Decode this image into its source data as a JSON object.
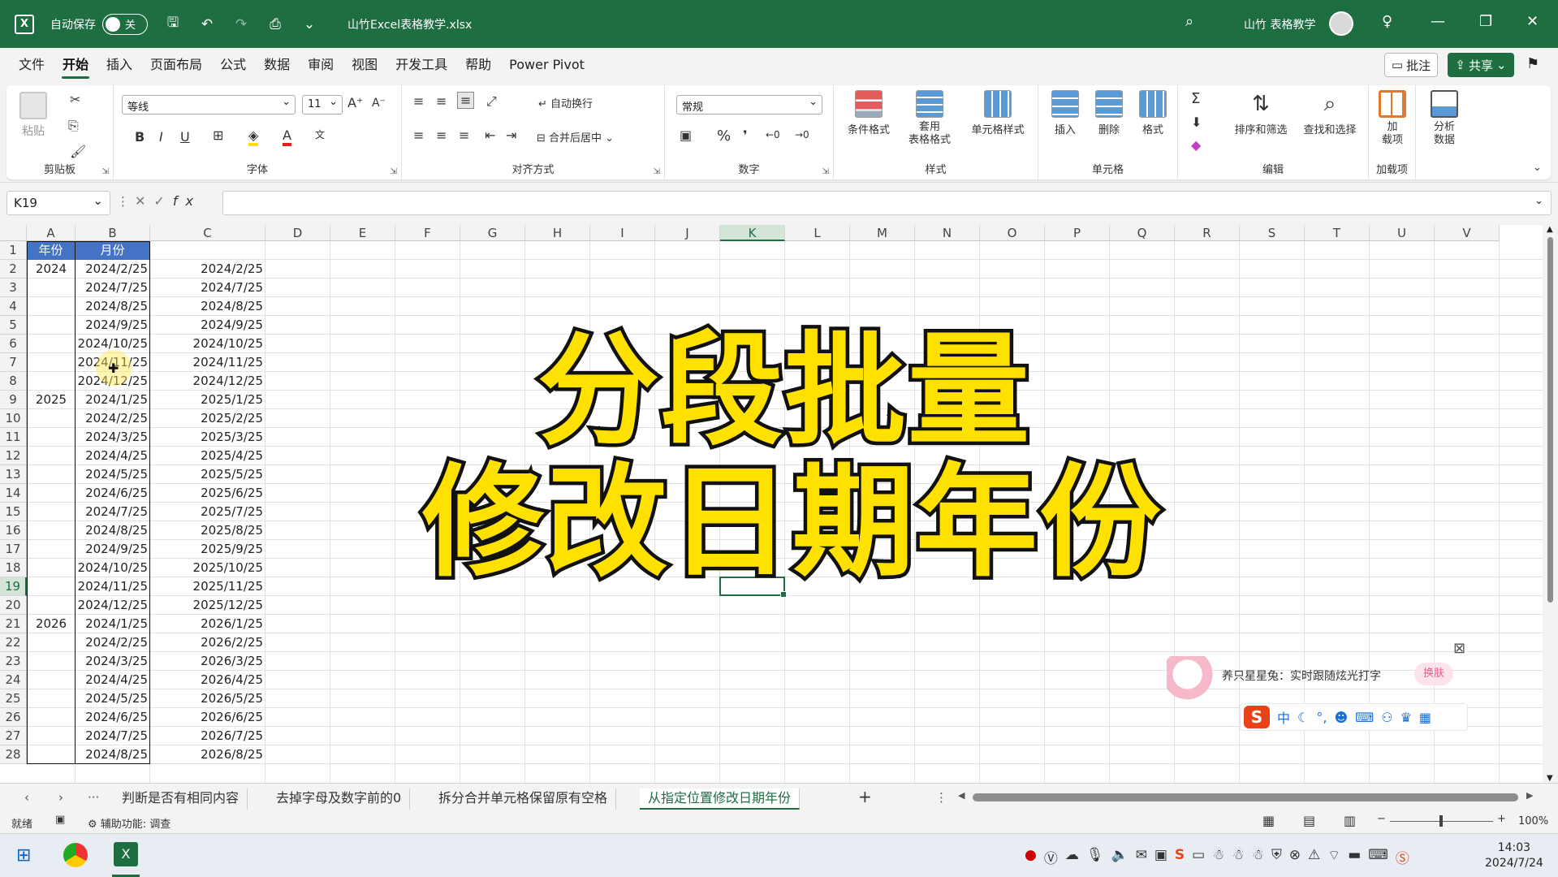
{
  "titlebar": {
    "autosave_label": "自动保存",
    "toggle_state": "关",
    "filename": "山竹Excel表格教学.xlsx",
    "username": "山竹 表格教学"
  },
  "menu": [
    "文件",
    "开始",
    "插入",
    "页面布局",
    "公式",
    "数据",
    "审阅",
    "视图",
    "开发工具",
    "帮助",
    "Power Pivot"
  ],
  "menu_active": "开始",
  "comment_label": "批注",
  "share_label": "共享",
  "ribbon": {
    "clipboard": {
      "paste": "粘贴",
      "label": "剪贴板"
    },
    "font": {
      "name": "等线",
      "size": "11",
      "label": "字体",
      "bold": "B",
      "italic": "I",
      "underline": "U"
    },
    "align": {
      "wrap": "自动换行",
      "merge": "合并后居中",
      "label": "对齐方式"
    },
    "number": {
      "format": "常规",
      "label": "数字",
      "percent": "%"
    },
    "styles": {
      "cond": "条件格式",
      "table_line1": "套用",
      "table_line2": "表格格式",
      "cell": "单元格样式",
      "label": "样式"
    },
    "cells": {
      "insert": "插入",
      "delete": "删除",
      "format": "格式",
      "label": "单元格"
    },
    "edit": {
      "sort": "排序和筛选",
      "find": "查找和选择",
      "label": "编辑"
    },
    "addins": {
      "btn_line1": "加",
      "btn_line2": "载项",
      "label": "加载项"
    },
    "analyze": {
      "line1": "分析",
      "line2": "数据"
    }
  },
  "namebox": "K19",
  "fx": "fx",
  "columns": [
    "A",
    "B",
    "C",
    "D",
    "E",
    "F",
    "G",
    "H",
    "I",
    "J",
    "K",
    "L",
    "M",
    "N",
    "O",
    "P",
    "Q",
    "R",
    "S",
    "T",
    "U",
    "V"
  ],
  "active_column": "K",
  "active_row": "19",
  "rows": [
    "1",
    "2",
    "3",
    "4",
    "5",
    "6",
    "7",
    "8",
    "9",
    "10",
    "11",
    "12",
    "13",
    "14",
    "15",
    "16",
    "17",
    "18",
    "19",
    "20",
    "21",
    "22",
    "23",
    "24",
    "25",
    "26",
    "27",
    "28"
  ],
  "header_a": "年份",
  "header_b": "月份",
  "col_a": {
    "2": "2024",
    "9": "2025",
    "21": "2026"
  },
  "col_b": [
    "2024/2/25",
    "2024/7/25",
    "2024/8/25",
    "2024/9/25",
    "2024/10/25",
    "2024/11/25",
    "2024/12/25",
    "2024/1/25",
    "2024/2/25",
    "2024/3/25",
    "2024/4/25",
    "2024/5/25",
    "2024/6/25",
    "2024/7/25",
    "2024/8/25",
    "2024/9/25",
    "2024/10/25",
    "2024/11/25",
    "2024/12/25",
    "2024/1/25",
    "2024/2/25",
    "2024/3/25",
    "2024/4/25",
    "2024/5/25",
    "2024/6/25",
    "2024/7/25",
    "2024/8/25"
  ],
  "col_c": [
    "2024/2/25",
    "2024/7/25",
    "2024/8/25",
    "2024/9/25",
    "2024/10/25",
    "2024/11/25",
    "2024/12/25",
    "2025/1/25",
    "2025/2/25",
    "2025/3/25",
    "2025/4/25",
    "2025/5/25",
    "2025/6/25",
    "2025/7/25",
    "2025/8/25",
    "2025/9/25",
    "2025/10/25",
    "2025/11/25",
    "2025/12/25",
    "2026/1/25",
    "2026/2/25",
    "2026/3/25",
    "2026/4/25",
    "2026/5/25",
    "2026/6/25",
    "2026/7/25",
    "2026/8/25"
  ],
  "overlay": {
    "line1": "分段批量",
    "line2": "修改日期年份",
    "fill": "#ffe100"
  },
  "ime": {
    "tip": "养只星星兔：实时跟随炫光打字",
    "skin": "换肤",
    "mode": "中"
  },
  "sheets": [
    "判断是否有相同内容",
    "去掉字母及数字前的0",
    "拆分合并单元格保留原有空格",
    "从指定位置修改日期年份"
  ],
  "active_sheet": "从指定位置修改日期年份",
  "status": {
    "ready": "就绪",
    "accessibility": "辅助功能: 调查",
    "zoom": "100%"
  },
  "clock": {
    "time": "14:03",
    "date": "2024/7/24"
  },
  "colors": {
    "accent": "#1e6e42",
    "table_header": "#4472c4"
  }
}
